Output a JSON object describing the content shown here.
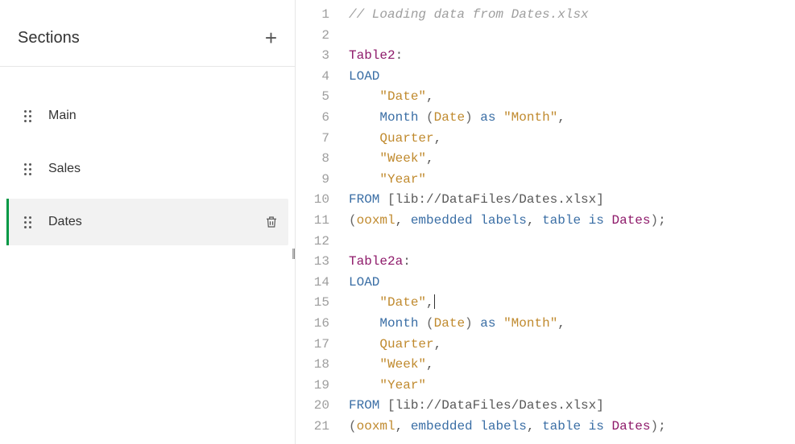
{
  "sidebar": {
    "title": "Sections",
    "add_label": "+",
    "items": [
      {
        "label": "Main",
        "active": false
      },
      {
        "label": "Sales",
        "active": false
      },
      {
        "label": "Dates",
        "active": true
      }
    ]
  },
  "editor": {
    "line_start": 1,
    "line_end": 21,
    "lines": [
      [
        {
          "c": "comment",
          "t": "// Loading data from Dates.xlsx"
        }
      ],
      [],
      [
        {
          "c": "label",
          "t": "Table2"
        },
        {
          "c": "plain",
          "t": ":"
        }
      ],
      [
        {
          "c": "keyword",
          "t": "LOAD"
        }
      ],
      [
        {
          "c": "plain",
          "t": "    "
        },
        {
          "c": "string",
          "t": "\"Date\""
        },
        {
          "c": "plain",
          "t": ","
        }
      ],
      [
        {
          "c": "plain",
          "t": "    "
        },
        {
          "c": "func",
          "t": "Month"
        },
        {
          "c": "plain",
          "t": " "
        },
        {
          "c": "paren",
          "t": "("
        },
        {
          "c": "id",
          "t": "Date"
        },
        {
          "c": "paren",
          "t": ")"
        },
        {
          "c": "plain",
          "t": " "
        },
        {
          "c": "as",
          "t": "as"
        },
        {
          "c": "plain",
          "t": " "
        },
        {
          "c": "string",
          "t": "\"Month\""
        },
        {
          "c": "plain",
          "t": ","
        }
      ],
      [
        {
          "c": "plain",
          "t": "    "
        },
        {
          "c": "id",
          "t": "Quarter"
        },
        {
          "c": "plain",
          "t": ","
        }
      ],
      [
        {
          "c": "plain",
          "t": "    "
        },
        {
          "c": "string",
          "t": "\"Week\""
        },
        {
          "c": "plain",
          "t": ","
        }
      ],
      [
        {
          "c": "plain",
          "t": "    "
        },
        {
          "c": "string",
          "t": "\"Year\""
        }
      ],
      [
        {
          "c": "keyword",
          "t": "FROM"
        },
        {
          "c": "plain",
          "t": " "
        },
        {
          "c": "bracket",
          "t": "[lib://DataFiles/Dates.xlsx]"
        }
      ],
      [
        {
          "c": "paren",
          "t": "("
        },
        {
          "c": "id",
          "t": "ooxml"
        },
        {
          "c": "plain",
          "t": ", "
        },
        {
          "c": "keyword",
          "t": "embedded labels"
        },
        {
          "c": "plain",
          "t": ", "
        },
        {
          "c": "keyword",
          "t": "table is"
        },
        {
          "c": "plain",
          "t": " "
        },
        {
          "c": "label",
          "t": "Dates"
        },
        {
          "c": "paren",
          "t": ")"
        },
        {
          "c": "plain",
          "t": ";"
        }
      ],
      [],
      [
        {
          "c": "label",
          "t": "Table2a"
        },
        {
          "c": "plain",
          "t": ":"
        }
      ],
      [
        {
          "c": "keyword",
          "t": "LOAD"
        }
      ],
      [
        {
          "c": "plain",
          "t": "    "
        },
        {
          "c": "string",
          "t": "\"Date\""
        },
        {
          "c": "plain",
          "t": ","
        },
        {
          "c": "caret",
          "t": ""
        }
      ],
      [
        {
          "c": "plain",
          "t": "    "
        },
        {
          "c": "func",
          "t": "Month"
        },
        {
          "c": "plain",
          "t": " "
        },
        {
          "c": "paren",
          "t": "("
        },
        {
          "c": "id",
          "t": "Date"
        },
        {
          "c": "paren",
          "t": ")"
        },
        {
          "c": "plain",
          "t": " "
        },
        {
          "c": "as",
          "t": "as"
        },
        {
          "c": "plain",
          "t": " "
        },
        {
          "c": "string",
          "t": "\"Month\""
        },
        {
          "c": "plain",
          "t": ","
        }
      ],
      [
        {
          "c": "plain",
          "t": "    "
        },
        {
          "c": "id",
          "t": "Quarter"
        },
        {
          "c": "plain",
          "t": ","
        }
      ],
      [
        {
          "c": "plain",
          "t": "    "
        },
        {
          "c": "string",
          "t": "\"Week\""
        },
        {
          "c": "plain",
          "t": ","
        }
      ],
      [
        {
          "c": "plain",
          "t": "    "
        },
        {
          "c": "string",
          "t": "\"Year\""
        }
      ],
      [
        {
          "c": "keyword",
          "t": "FROM"
        },
        {
          "c": "plain",
          "t": " "
        },
        {
          "c": "bracket",
          "t": "[lib://DataFiles/Dates.xlsx]"
        }
      ],
      [
        {
          "c": "paren",
          "t": "("
        },
        {
          "c": "id",
          "t": "ooxml"
        },
        {
          "c": "plain",
          "t": ", "
        },
        {
          "c": "keyword",
          "t": "embedded labels"
        },
        {
          "c": "plain",
          "t": ", "
        },
        {
          "c": "keyword",
          "t": "table is"
        },
        {
          "c": "plain",
          "t": " "
        },
        {
          "c": "label",
          "t": "Dates"
        },
        {
          "c": "paren",
          "t": ")"
        },
        {
          "c": "plain",
          "t": ";"
        }
      ]
    ]
  }
}
